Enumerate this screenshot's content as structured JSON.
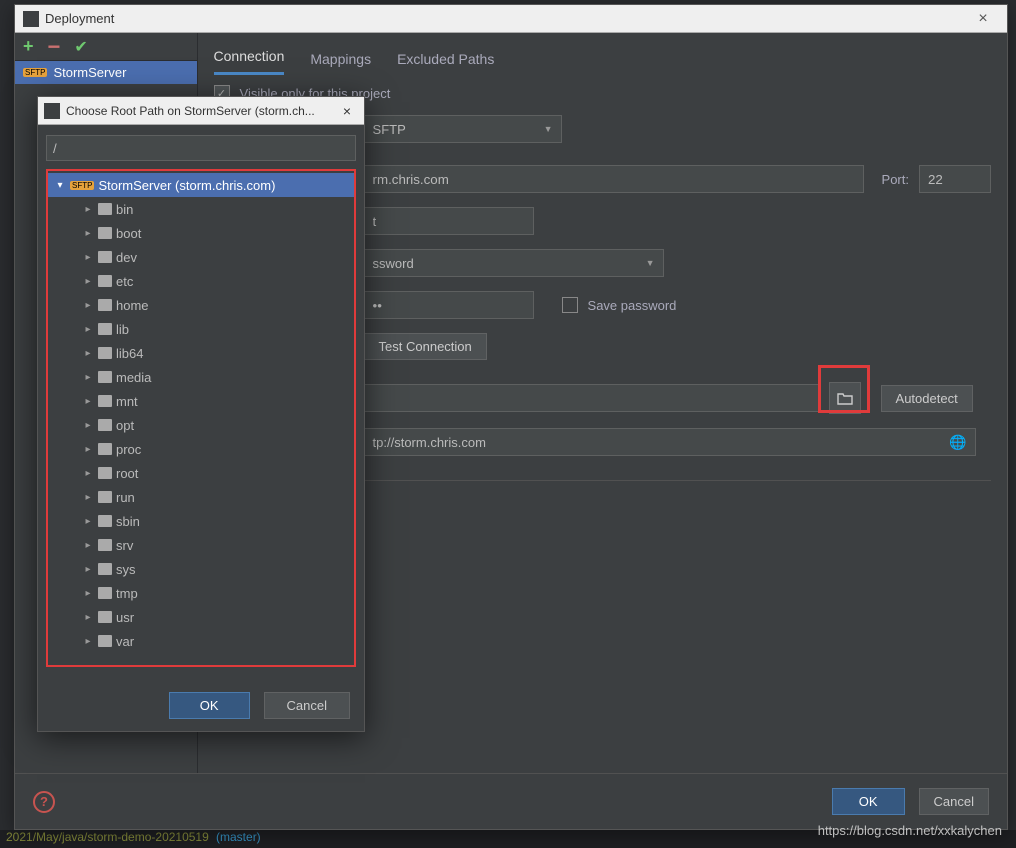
{
  "window": {
    "title": "Deployment"
  },
  "sidebar": {
    "server_label": "StormServer"
  },
  "tabs": {
    "connection": "Connection",
    "mappings": "Mappings",
    "excluded": "Excluded Paths"
  },
  "form": {
    "visible_only": "Visible only for this project",
    "type_value": "SFTP",
    "host_value": "rm.chris.com",
    "port_label": "Port:",
    "port_value": "22",
    "user_value": "t",
    "auth_value": "ssword",
    "pwd_value": "••",
    "save_pwd": "Save password",
    "test_conn": "Test Connection",
    "autodetect": "Autodetect",
    "url_value": "tp://storm.chris.com"
  },
  "footer": {
    "ok": "OK",
    "cancel": "Cancel"
  },
  "popup": {
    "title": "Choose Root Path on StormServer (storm.ch...",
    "path": "/",
    "root_label": "StormServer (storm.chris.com)",
    "folders": [
      "bin",
      "boot",
      "dev",
      "etc",
      "home",
      "lib",
      "lib64",
      "media",
      "mnt",
      "opt",
      "proc",
      "root",
      "run",
      "sbin",
      "srv",
      "sys",
      "tmp",
      "usr",
      "var"
    ],
    "ok": "OK",
    "cancel": "Cancel"
  },
  "watermark": "https://blog.csdn.net/xxkalychen",
  "bottom": {
    "path": "2021/May/java/storm-demo-20210519",
    "branch": "(master)"
  }
}
